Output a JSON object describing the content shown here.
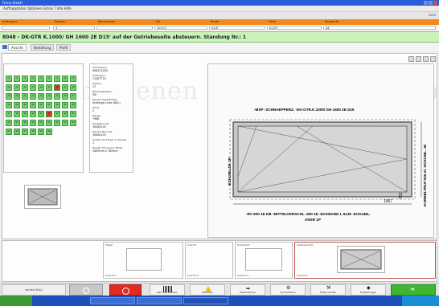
{
  "window": {
    "title": "Firma GmbH"
  },
  "menu": {
    "text": "Auftragsdaten Optionen Extras ? Info Hilfe"
  },
  "toolbar": {
    "right_value": "2023"
  },
  "header": {
    "labels": [
      "Auftragsnr.",
      "Position",
      "Kommission",
      "Stk",
      "Breite",
      "Höhe",
      "Bauteil-Nr."
    ],
    "values": [
      "",
      "1",
      "",
      "101/17",
      "A1/9",
      "A1/29",
      "A4"
    ]
  },
  "message": "8048 - DK-GTR K.1000/ GH 1600 2E D15' auf der Getriebeseite absteuern. Standung Nr.: 1",
  "tabs": [
    "Ansicht",
    "Bestellung",
    "Profil"
  ],
  "grid": {
    "rows": [
      [
        "1",
        "2",
        "3",
        "4",
        "5",
        "6",
        "7",
        "8",
        "9"
      ],
      [
        "10",
        "11",
        "12",
        "13",
        "14",
        "15",
        "16",
        "17",
        "18"
      ],
      [
        "19",
        "20",
        "21",
        "22",
        "23",
        "24",
        "25",
        "26",
        "27"
      ],
      [
        "28",
        "29",
        "30",
        "31",
        "32",
        "33",
        "34",
        "35",
        "36"
      ],
      [
        "37",
        "38",
        "39",
        "40",
        "41",
        "42",
        "43",
        "44",
        "45"
      ],
      [
        "46",
        "47",
        "48",
        "49",
        "50",
        "51",
        "52",
        "53",
        "54"
      ],
      [
        "55",
        "56",
        "57",
        "58",
        "59",
        "60",
        "",
        "",
        ""
      ]
    ],
    "red": [
      "16",
      "42"
    ]
  },
  "info": [
    {
      "k": "Kommission",
      "v": "000011020"
    },
    {
      "k": "Auftragsnr.",
      "v": "21007719"
    },
    {
      "k": "Position",
      "v": "17"
    },
    {
      "k": "Beschlagsystem",
      "v": "SIE"
    },
    {
      "k": "Fenster Spezifikation",
      "v": "Drehkipp Links (DKL)"
    },
    {
      "k": "Farbe",
      "v": "2"
    },
    {
      "k": "Menge",
      "v": "7960"
    },
    {
      "k": "Preis/Barcode",
      "v": "30400143"
    },
    {
      "k": "Fenster Barcode",
      "v": "30400143"
    },
    {
      "k": "Anzahl der Flügel im Fenster",
      "v": "1"
    },
    {
      "k": "Fenster Dimension (BxH)",
      "v": "1067mm x 762mm"
    }
  ],
  "drawing": {
    "top_label": "-MSP -SCHNAEPPERZ. -DK-GTR.K.1000/ GH 1600 2E D15",
    "left_label": "-ECKUML.DK 1P",
    "right_label": "-KURBELTRLP 556 01 -ECKUML. 1E",
    "bottom_label_1": "-RV 600 1E KB -MITTELVERSCHL. 600 1E -ECKBAND L 6139 -ECKUML.",
    "bottom_label_2": "ANSR 1P",
    "dim_h": "1067",
    "dim_v": "762"
  },
  "watermark": "ebenen",
  "bottom_panels": [
    {
      "title": "Flügel",
      "caption": "Ansicht 1"
    },
    {
      "title": "Ansicht",
      "caption": "Ansicht 2"
    },
    {
      "title": "Draufsicht",
      "caption": "Ansicht 3"
    },
    {
      "title": "Seitenansicht",
      "caption": "Ansicht 4"
    }
  ],
  "function_buttons": [
    "Barcode drucken",
    "Etiketten",
    "Übernehmen",
    "Kontrollieren",
    "Fertig melden",
    "Einstellungen"
  ],
  "status": {
    "left_text": "zurück (Esc)"
  },
  "colors": {
    "accent_orange": "#f08a1c",
    "message_green": "#c9f3b8",
    "cell_green": "#6fd06a",
    "cell_red": "#e03a2a",
    "exit_green": "#3fb531"
  }
}
